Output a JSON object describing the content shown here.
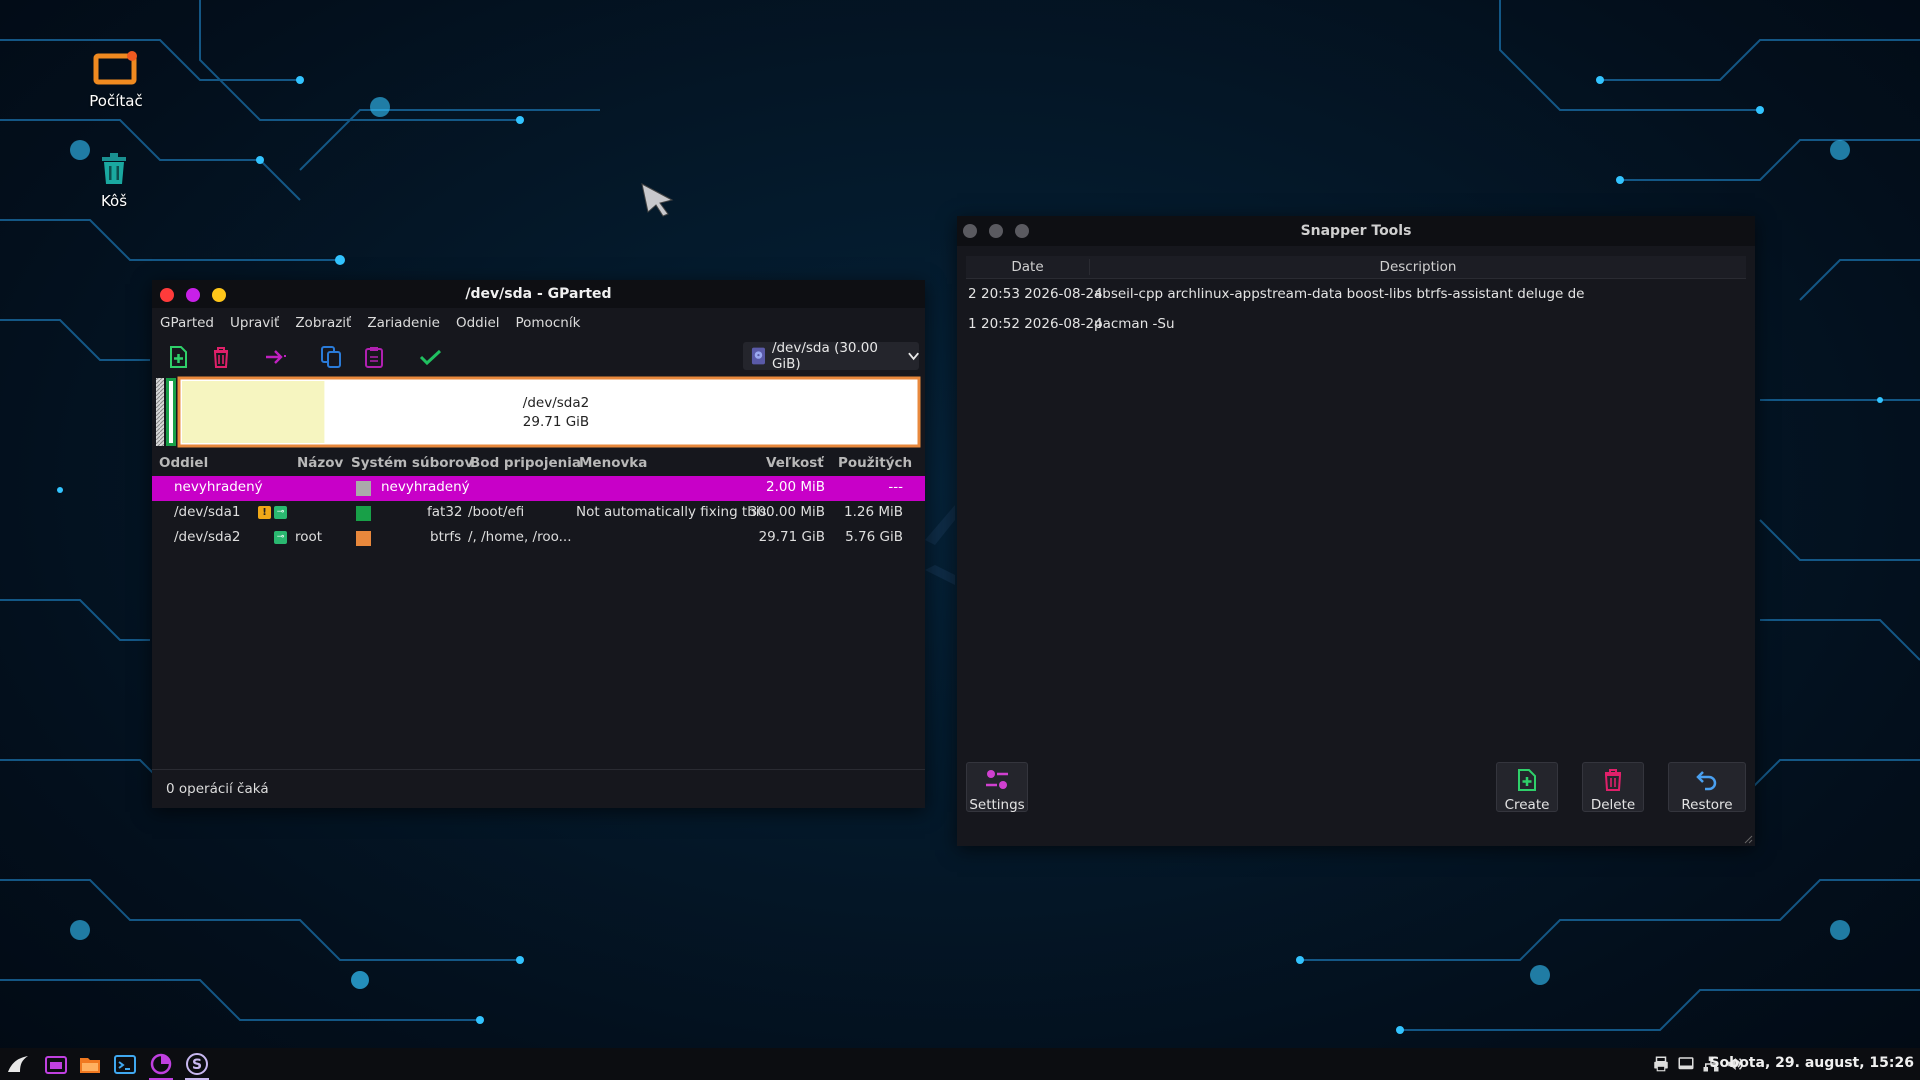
{
  "desktop": {
    "icons": [
      {
        "label": "Počítač"
      },
      {
        "label": "Kôš"
      }
    ]
  },
  "gparted": {
    "title": "/dev/sda - GParted",
    "menu": [
      "GParted",
      "Upraviť",
      "Zobraziť",
      "Zariadenie",
      "Oddiel",
      "Pomocník"
    ],
    "device": "/dev/sda (30.00 GiB)",
    "diskmap": {
      "label": "/dev/sda2",
      "size": "29.71 GiB",
      "used_fraction": 0.194
    },
    "columns": [
      "Oddiel",
      "Názov",
      "Systém súborov",
      "Bod pripojenia",
      "Menovka",
      "Veľkosť",
      "Použitých"
    ],
    "rows": [
      {
        "partition": "nevyhradený",
        "name": "",
        "fs": "nevyhradený",
        "mount": "",
        "label": "",
        "size": "2.00 MiB",
        "used": "---",
        "fs_color": "#aaaaaa"
      },
      {
        "partition": "/dev/sda1",
        "name": "",
        "fs": "fat32",
        "mount": "/boot/efi",
        "label": "Not automatically fixing this.",
        "size": "300.00 MiB",
        "used": "1.26 MiB",
        "fs_color": "#18a048"
      },
      {
        "partition": "/dev/sda2",
        "name": "root",
        "fs": "btrfs",
        "mount": "/, /home, /roo...",
        "label": "",
        "size": "29.71 GiB",
        "used": "5.76 GiB",
        "fs_color": "#e8883c"
      }
    ],
    "status": "0 operácií čaká",
    "colors": {
      "selected": "#c800c8",
      "accent": "#e8883c"
    }
  },
  "snapper": {
    "title": "Snapper Tools",
    "columns": [
      "Date",
      "Description"
    ],
    "snapshots": [
      {
        "num": "2",
        "date": "20:53 2026-08-24",
        "desc": "abseil-cpp archlinux-appstream-data boost-libs btrfs-assistant deluge de"
      },
      {
        "num": "1",
        "date": "20:52 2026-08-24",
        "desc": "pacman -Su"
      }
    ],
    "buttons": {
      "settings": "Settings",
      "create": "Create",
      "delete": "Delete",
      "restore": "Restore"
    }
  },
  "taskbar": {
    "clock": "Sobota, 29. august, 15:26"
  }
}
